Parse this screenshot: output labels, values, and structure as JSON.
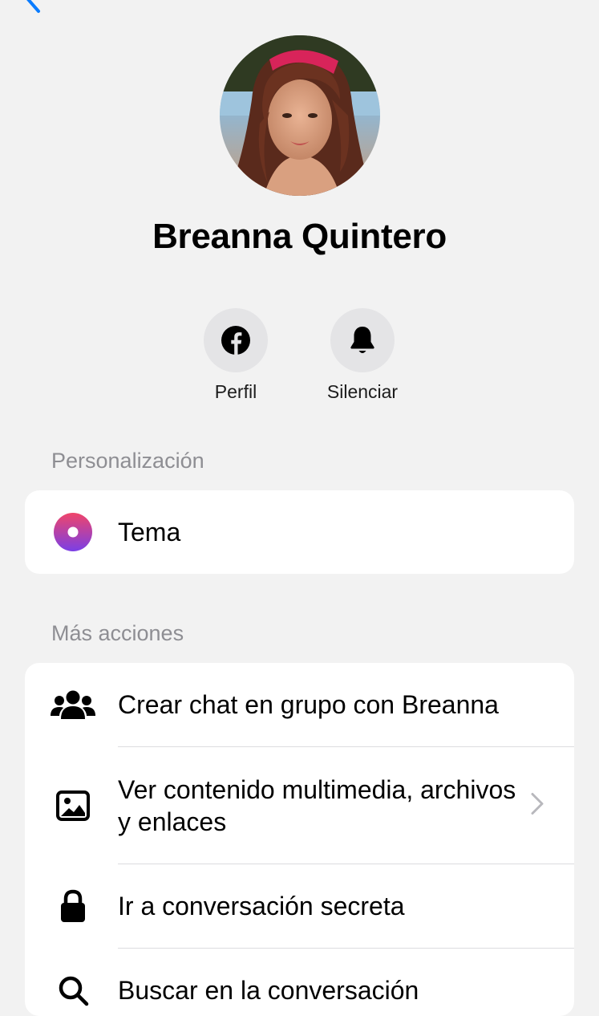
{
  "profile": {
    "name": "Breanna Quintero"
  },
  "actions": {
    "profile_label": "Perfil",
    "mute_label": "Silenciar"
  },
  "sections": {
    "personalization": {
      "title": "Personalización",
      "theme_label": "Tema"
    },
    "more_actions": {
      "title": "Más acciones",
      "items": [
        {
          "label": "Crear chat en grupo con Breanna",
          "icon": "group-icon"
        },
        {
          "label": "Ver contenido multimedia, archivos y enlaces",
          "icon": "image-icon"
        },
        {
          "label": "Ir a conversación secreta",
          "icon": "lock-icon"
        },
        {
          "label": "Buscar en la conversación",
          "icon": "search-icon"
        }
      ]
    }
  },
  "colors": {
    "accent": "#0a7cff",
    "background": "#f2f2f2",
    "card": "#ffffff",
    "section_title": "#8e8e93",
    "theme_gradient_start": "#e63e6b",
    "theme_gradient_end": "#7b3fe4"
  }
}
